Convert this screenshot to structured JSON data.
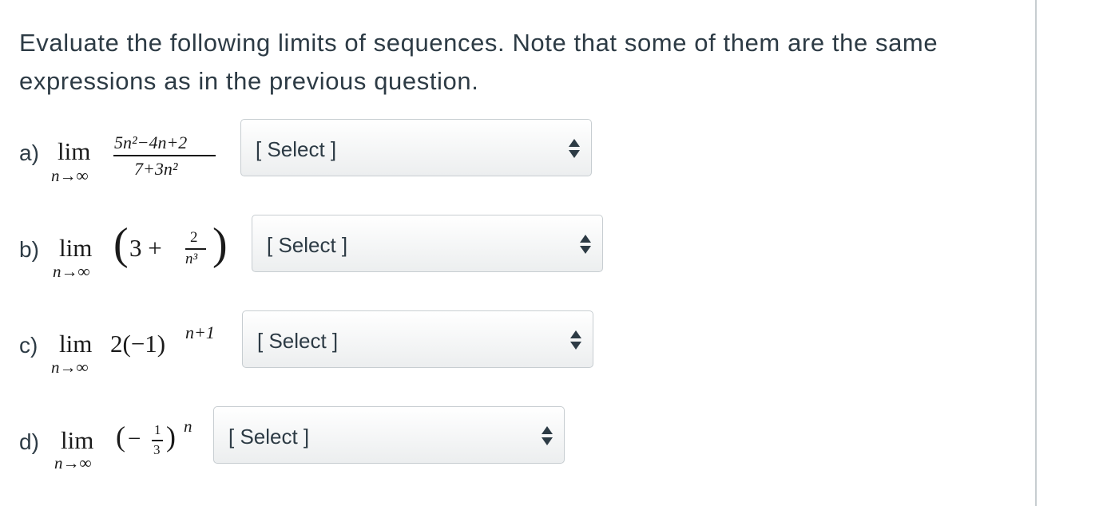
{
  "question": {
    "instructions": "Evaluate the following limits of sequences. Note that some of them are the same expressions as in the previous question."
  },
  "parts": [
    {
      "label": "a)",
      "lim": "lim",
      "under": "n→∞",
      "numerator": "5n²−4n+2",
      "denominator": "7+3n²",
      "select_value": "[ Select ]"
    },
    {
      "label": "b)",
      "lim": "lim",
      "under": "n→∞",
      "lead": "3 +",
      "numerator": "2",
      "denominator": "n³",
      "select_value": "[ Select ]"
    },
    {
      "label": "c)",
      "lim": "lim",
      "under": "n→∞",
      "expression": "2(−1)",
      "exponent": "n+1",
      "select_value": "[ Select ]"
    },
    {
      "label": "d)",
      "lim": "lim",
      "under": "n→∞",
      "sign": "−",
      "numerator": "1",
      "denominator": "3",
      "exponent": "n",
      "select_value": "[ Select ]"
    }
  ]
}
